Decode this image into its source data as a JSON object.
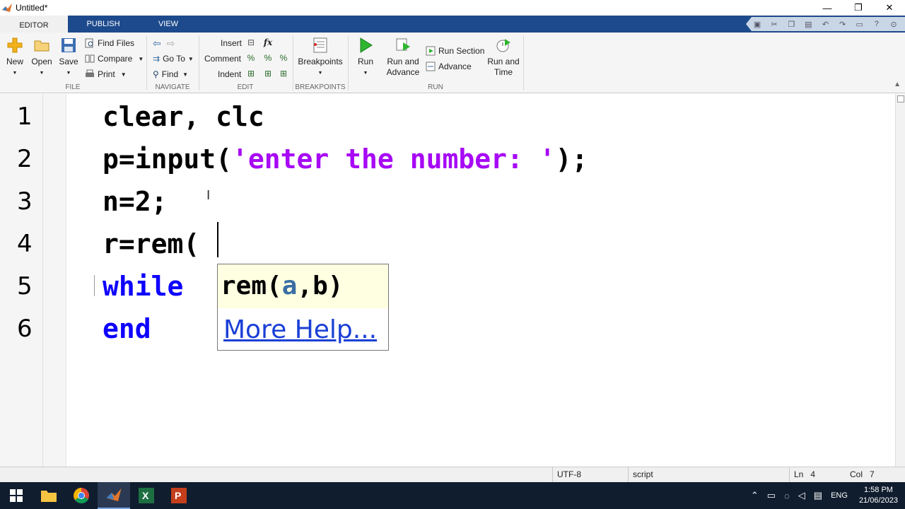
{
  "window": {
    "title": "Untitled*",
    "minimize": "—",
    "restore": "❐",
    "close": "✕"
  },
  "tabs": [
    {
      "label": "EDITOR",
      "active": true
    },
    {
      "label": "PUBLISH",
      "active": false
    },
    {
      "label": "VIEW",
      "active": false
    }
  ],
  "ribbon": {
    "file": {
      "label": "FILE",
      "new": "New",
      "open": "Open",
      "save": "Save",
      "find_files": "Find Files",
      "compare": "Compare",
      "print": "Print"
    },
    "navigate": {
      "label": "NAVIGATE",
      "go_to": "Go To",
      "find": "Find"
    },
    "edit": {
      "label": "EDIT",
      "insert": "Insert",
      "comment": "Comment",
      "indent": "Indent",
      "fx": "fx"
    },
    "breakpoints": {
      "label": "BREAKPOINTS",
      "breakpoints": "Breakpoints"
    },
    "run": {
      "label": "RUN",
      "run": "Run",
      "run_and_advance_1": "Run and",
      "run_and_advance_2": "Advance",
      "run_section": "Run Section",
      "advance": "Advance",
      "run_and_time_1": "Run and",
      "run_and_time_2": "Time"
    }
  },
  "editor": {
    "line_numbers": [
      "1",
      "2",
      "3",
      "4",
      "5",
      "6"
    ],
    "lines": {
      "l1": "clear, clc",
      "l2a": "p=input(",
      "l2b": "'enter the number: '",
      "l2c": ");",
      "l3": "n=2;",
      "l4": "r=rem(",
      "l5": "while",
      "l6": "end"
    },
    "tooltip": {
      "fn": "rem(",
      "arg_a": "a",
      "rest": ",b)",
      "more_help": "More Help..."
    }
  },
  "statusbar": {
    "encoding": "UTF-8",
    "type": "script",
    "ln_label": "Ln",
    "ln": "4",
    "col_label": "Col",
    "col": "7"
  },
  "taskbar": {
    "time": "1:58 PM",
    "date": "21/06/2023",
    "lang": "ENG"
  },
  "colors": {
    "keyword": "#0e00ff",
    "string": "#a709f5",
    "ribbon_tab": "#1d4a8c",
    "taskbar": "#101d2e"
  }
}
